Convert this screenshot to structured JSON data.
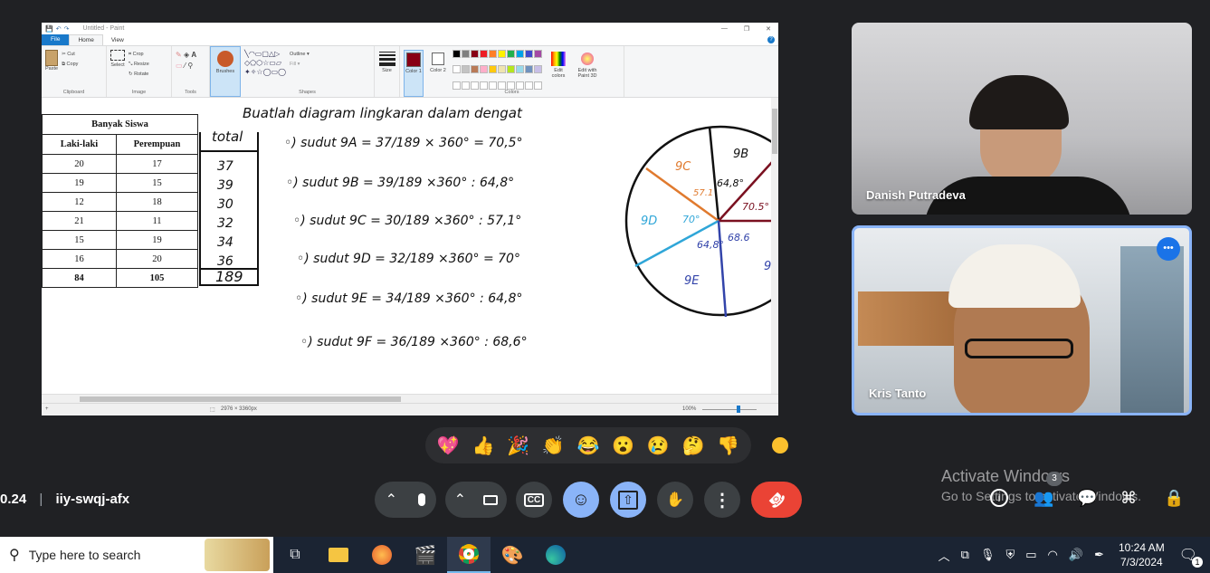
{
  "paint": {
    "title": "Untitled - Paint",
    "menu": {
      "file": "File",
      "home": "Home",
      "view": "View"
    },
    "ribbon": {
      "paste": "Paste",
      "cut": "Cut",
      "copy": "Copy",
      "crop": "Crop",
      "resize": "Resize",
      "rotate": "Rotate",
      "select": "Select",
      "brushes": "Brushes",
      "outline": "Outline",
      "fill": "Fill",
      "size": "Size",
      "color1": "Color 1",
      "color2": "Color 2",
      "edit_colors": "Edit colors",
      "edit_paint3d": "Edit with Paint 3D",
      "groups": [
        "Clipboard",
        "Image",
        "Tools",
        "Shapes",
        "Colors"
      ],
      "palette": [
        "#000000",
        "#7f7f7f",
        "#880015",
        "#ed1c24",
        "#ff7f27",
        "#fff200",
        "#22b14c",
        "#00a2e8",
        "#3f48cc",
        "#a349a4",
        "#ffffff",
        "#c3c3c3",
        "#b97a57",
        "#ffaec9",
        "#ffc90e",
        "#efe4b0",
        "#b5e61d",
        "#99d9ea",
        "#7092be",
        "#c8bfe7"
      ],
      "color1_value": "#880015"
    },
    "status": {
      "dimensions": "2976 × 3360px",
      "zoom": "100%"
    },
    "table": {
      "caption": "Banyak Siswa",
      "headers": [
        "Laki-laki",
        "Perempuan"
      ],
      "rows": [
        [
          "20",
          "17"
        ],
        [
          "19",
          "15"
        ],
        [
          "12",
          "18"
        ],
        [
          "21",
          "11"
        ],
        [
          "15",
          "19"
        ],
        [
          "16",
          "20"
        ]
      ],
      "totals": [
        "84",
        "105"
      ]
    },
    "handwriting": {
      "heading": "Buatlah diagram lingkaran dalam dengat",
      "total_header": "total",
      "totals": [
        "37",
        "39",
        "30",
        "32",
        "34",
        "36"
      ],
      "grand_total": "189",
      "lines": [
        "◦) sudut 9A = 37/189 × 360° = 70,5°",
        "◦) sudut 9B = 39/189 ×360° : 64,8°",
        "◦) sudut 9C = 30/189 ×360° : 57,1°",
        "◦) sudut 9D = 32/189 ×360° = 70°",
        "◦) sudut 9E = 34/189 ×360° : 64,8°",
        "◦) sudut 9F = 36/189 ×360° : 68,6°"
      ],
      "pie_labels": {
        "9b": "9B",
        "9c": "9C",
        "9d": "9D",
        "9e": "9E",
        "9f": "9",
        "a705": "70.5°",
        "a648": "64,8°",
        "a571": "57.1",
        "a70": "70°",
        "a648b": "64,8°",
        "a686": "68.6"
      }
    }
  },
  "participants": [
    {
      "name": "Danish Putradeva"
    },
    {
      "name": "Kris Tanto",
      "more": "•••"
    }
  ],
  "reactions": [
    "💖",
    "👍",
    "🎉",
    "👏",
    "😂",
    "😮",
    "😢",
    "🤔",
    "👎",
    "🟡"
  ],
  "meeting": {
    "time": "0.24",
    "code": "iiy-swqj-afx"
  },
  "controls": {
    "chevron": "⌃",
    "mic": "🎤",
    "camera": "🎥",
    "captions": "CC",
    "emoji": "☺",
    "present": "⇧",
    "hand": "✋",
    "more": "⋮",
    "end": "☎"
  },
  "activate": {
    "line1": "Activate Windows",
    "line2": "Go to Settings to activate Windows."
  },
  "people_badge": "3",
  "taskbar": {
    "search_placeholder": "Type here to search",
    "time": "10:24 AM",
    "date": "7/3/2024",
    "notif_count": "1"
  }
}
